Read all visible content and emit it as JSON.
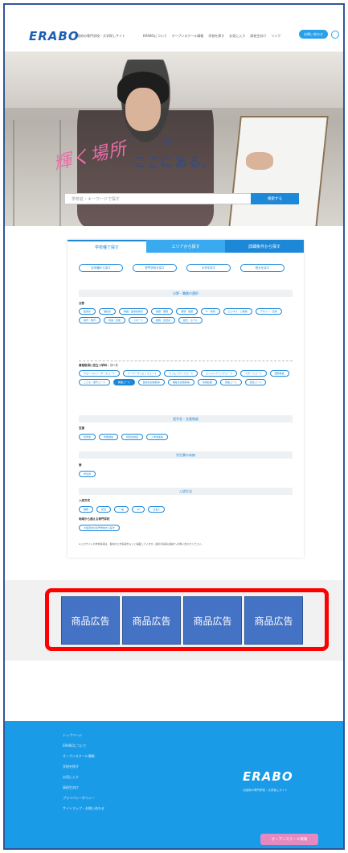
{
  "header": {
    "logo": "ERABO",
    "tagline": "大阪府の専門学校・大学探しサイト",
    "nav": [
      "ERABOについて",
      "オープンスクール情報",
      "学校を探す",
      "お気に入り",
      "高校生向け",
      "リンク"
    ],
    "menu_button": "お問い合わせ"
  },
  "hero": {
    "catch_main": "輝く場所",
    "catch_ga": "が",
    "catch_sub": "ここにある。",
    "search_placeholder": "学校名・キーワードで探す",
    "search_button": "検索する"
  },
  "search_panel": {
    "tabs": [
      "学校種で探す",
      "エリアから探す",
      "詳細条件から探す"
    ],
    "school_types": [
      "全学種から探す",
      "専門学校を探す",
      "大学を探す",
      "短大を探す"
    ],
    "sec1": "分野・職業の選択",
    "sec1_label": "分野",
    "sec1_chips": [
      "医療系",
      "福祉系",
      "看護・医療技術系",
      "美容・服飾",
      "調理・製菓",
      "IT・情報",
      "ビジネス・公務員",
      "デザイン・芸術",
      "保育・教育",
      "音楽・芸能",
      "スポーツ",
      "動物・自然系",
      "観光・ホテル"
    ],
    "sec1_label2": "資格取得に役立つ学科・コース",
    "sec1_chips2": [
      "グローバルリーダーズコース",
      "スーパーサイエンスコース",
      "クリエイティブコース",
      "エンジニアリングコース",
      "スポーツコース",
      "国際教養",
      "こども・保育コース",
      "看護コース",
      "医療系資格取得",
      "福祉系資格取得",
      "情報処理",
      "英語コース",
      "総合コース"
    ],
    "sec2": "奨学金・支援制度",
    "sec2_label": "支援",
    "sec2_chips": [
      "奨学金",
      "学費減免",
      "特待生制度",
      "入学金免除"
    ],
    "sec3": "学生寮の有無",
    "sec3_label": "寮",
    "sec3_chips": [
      "学生寮"
    ],
    "sec4": "入試方法",
    "sec4_label": "入試方式",
    "sec4_chips": [
      "推薦",
      "総合",
      "一般",
      "AO",
      "社会人"
    ],
    "sec4_label2": "地域から通える専門学校",
    "sec4_chips2": [
      "大阪府内の専門学校から探す"
    ],
    "notes": "※このサイトの学校情報は、各校の公式情報をもとに掲載しています。最新の情報は各校へお問い合わせください。"
  },
  "ads": [
    "商品広告",
    "商品広告",
    "商品広告",
    "商品広告"
  ],
  "footer": {
    "links": [
      "トップページ",
      "ERABOについて",
      "オープンスクール情報",
      "学校を探す",
      "お気に入り",
      "高校生向け",
      "プライバシーポリシー",
      "サイトマップ・お問い合わせ"
    ],
    "logo": "ERABO",
    "sub": "大阪府の専門学校・大学探しサイト",
    "cta": "オープンスクール情報"
  }
}
